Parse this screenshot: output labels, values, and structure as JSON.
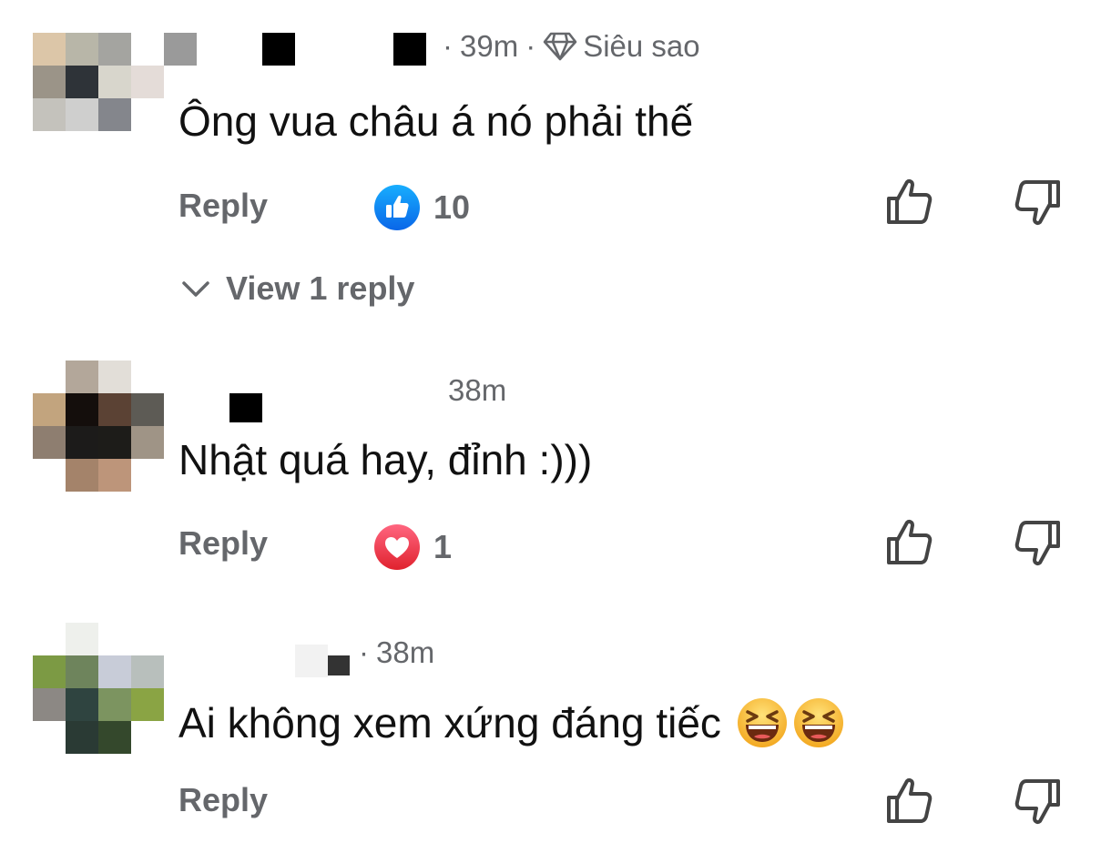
{
  "comments": [
    {
      "time": "39m",
      "badge_label": "Siêu sao",
      "badge_icon": "diamond-icon",
      "text": "Ông vua châu á nó phải thế",
      "reply_label": "Reply",
      "reaction_icon": "like-reaction-icon",
      "reaction_color": "#1877f2",
      "reaction_count": "10",
      "view_replies_label": "View 1 reply"
    },
    {
      "time": "38m",
      "text": "Nhật quá hay, đỉnh :)))",
      "reply_label": "Reply",
      "reaction_icon": "love-reaction-icon",
      "reaction_color": "#e8364a",
      "reaction_count": "1"
    },
    {
      "time": "38m",
      "text": "Ai không xem xứng đáng tiếc",
      "emojis": [
        "laughing-emoji",
        "laughing-emoji"
      ],
      "reply_label": "Reply"
    }
  ],
  "icons": {
    "like": "thumbs-up-outline-icon",
    "dislike": "thumbs-down-outline-icon",
    "expand": "chevron-down-icon"
  }
}
